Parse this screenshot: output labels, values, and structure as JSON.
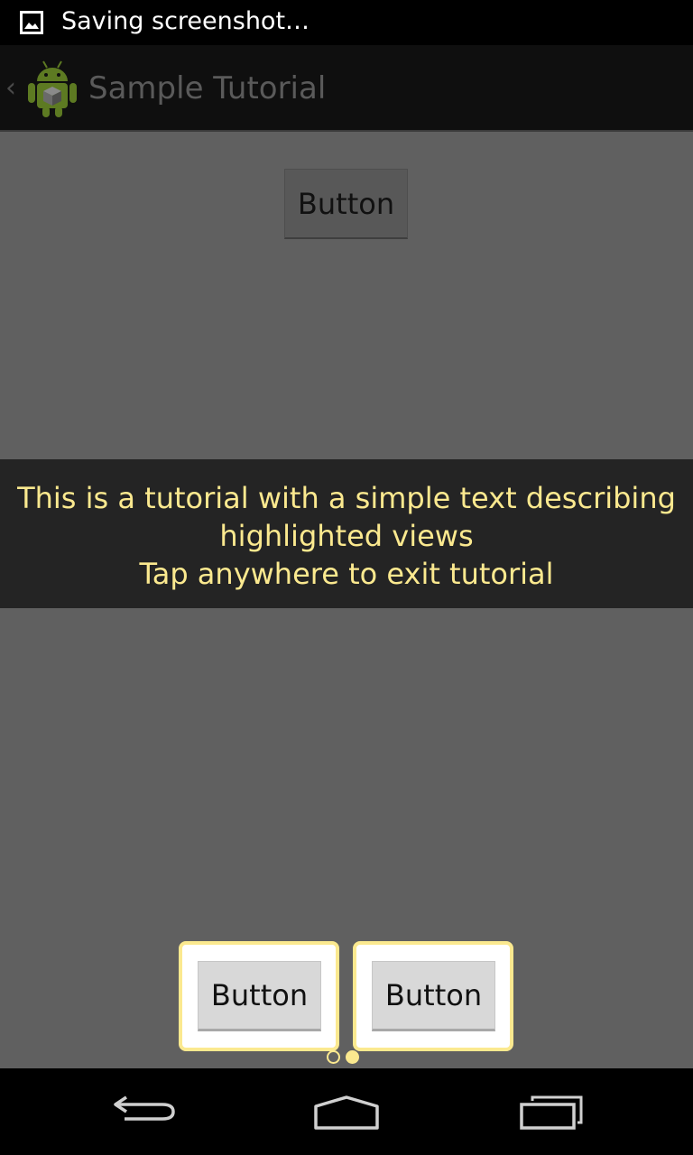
{
  "status_bar": {
    "notification_text": "Saving screenshot…",
    "icon": "image-icon"
  },
  "action_bar": {
    "title": "Sample Tutorial",
    "up_icon": "chevron-left-icon",
    "app_icon": "android-icon"
  },
  "main": {
    "top_button_label": "Button"
  },
  "tutorial": {
    "line1": "This is a tutorial with a simple text describing",
    "line2": "highlighted views",
    "line3": "Tap anywhere to exit tutorial"
  },
  "highlighted_buttons": [
    {
      "label": "Button"
    },
    {
      "label": "Button"
    }
  ],
  "page_indicator": {
    "total_pages": 2,
    "current_page": 2
  },
  "navigation_bar": {
    "back_icon": "back-icon",
    "home_icon": "home-icon",
    "recents_icon": "recents-icon"
  },
  "colors": {
    "overlay": "#606060",
    "tutorial_text": "#fbe98f",
    "tutorial_band": "#242424",
    "highlight_border": "#fbe98f"
  }
}
